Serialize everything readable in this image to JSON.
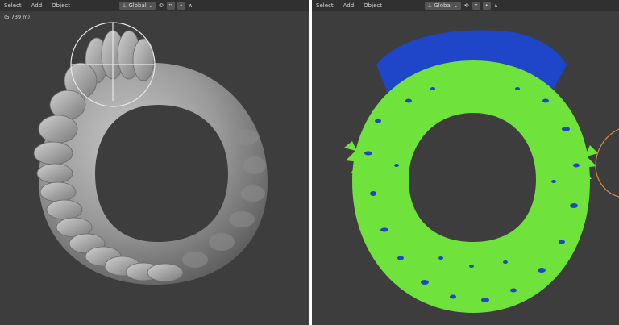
{
  "left_viewport": {
    "menu": [
      "Select",
      "Add",
      "Object"
    ],
    "orientation_label": "Global",
    "coordinate_readout": "(5.739 m)"
  },
  "right_viewport": {
    "menu": [
      "Select",
      "Add",
      "Object"
    ],
    "orientation_label": "Global"
  },
  "colors": {
    "viewport_bg": "#3d3d3d",
    "header_bg": "#303030",
    "mesh_gray": "#9a9a9a",
    "weight_green": "#6fe23b",
    "weight_blue": "#1f45c8",
    "gizmo_orange": "#e08a3c"
  },
  "icons": [
    "transform-pivot-icon",
    "snap-icon",
    "proportional-edit-icon",
    "gizmo-icon",
    "overlay-icon"
  ]
}
